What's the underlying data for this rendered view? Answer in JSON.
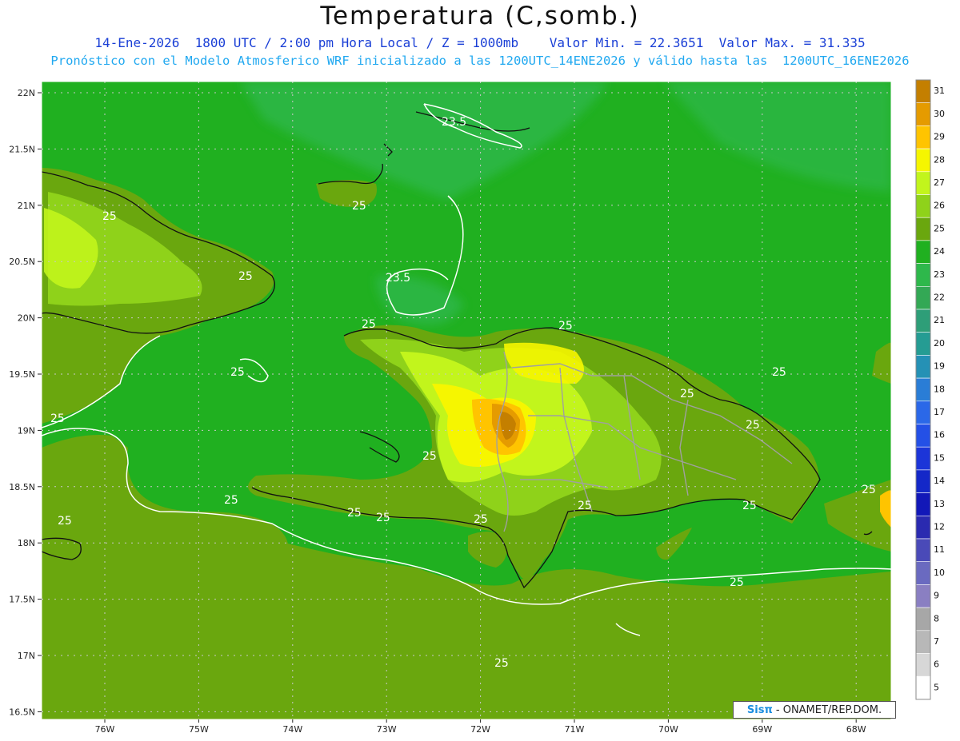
{
  "header": {
    "title": "Temperatura (C,somb.)",
    "line1": "14-Ene-2026  1800 UTC / 2:00 pm Hora Local / Z = 1000mb    Valor Min. = 22.3651  Valor Max. = 31.335",
    "line2": "Pronóstico con el Modelo Atmosferico WRF inicializado a las 1200UTC_14ENE2026 y válido hasta las  1200UTC_16ENE2026"
  },
  "axes": {
    "lat_labels": [
      "22N",
      "21.5N",
      "21N",
      "20.5N",
      "20N",
      "19.5N",
      "19N",
      "18.5N",
      "18N",
      "17.5N",
      "17N",
      "16.5N"
    ],
    "lon_labels": [
      "76W",
      "75W",
      "74W",
      "73W",
      "72W",
      "71W",
      "70W",
      "69W",
      "68W"
    ]
  },
  "colorbar": {
    "labels": [
      "31",
      "30",
      "29",
      "28",
      "27",
      "26",
      "25",
      "24",
      "23",
      "22",
      "21",
      "20",
      "19",
      "18",
      "17",
      "16",
      "15",
      "14",
      "13",
      "12",
      "11",
      "10",
      "9",
      "8",
      "7",
      "6",
      "5"
    ],
    "colors": [
      "#c47f00",
      "#e59b00",
      "#ffc400",
      "#f6f600",
      "#c2f51c",
      "#8fd21a",
      "#6aa70e",
      "#20b020",
      "#2eb84b",
      "#33a855",
      "#2e9e78",
      "#259c93",
      "#2591b5",
      "#2a7dd6",
      "#2b68e8",
      "#2450e6",
      "#1c35d8",
      "#1428c8",
      "#1218b8",
      "#2a2ab0",
      "#4a4ab8",
      "#6a6ac0",
      "#8a7fc2",
      "#a7a7a7",
      "#b8b8b8",
      "#d7d7d7",
      "#ffffff"
    ]
  },
  "contour_labels": [
    "23.5",
    "25",
    "25",
    "25",
    "25",
    "25",
    "25",
    "25",
    "23.5",
    "25",
    "25",
    "25",
    "25",
    "25",
    "25",
    "25",
    "25",
    "25",
    "25",
    "25",
    "25",
    "25",
    "25",
    "25",
    "25"
  ],
  "credit": {
    "logo": "Sisπ",
    "text": " - ONAMET/REP.DOM."
  }
}
